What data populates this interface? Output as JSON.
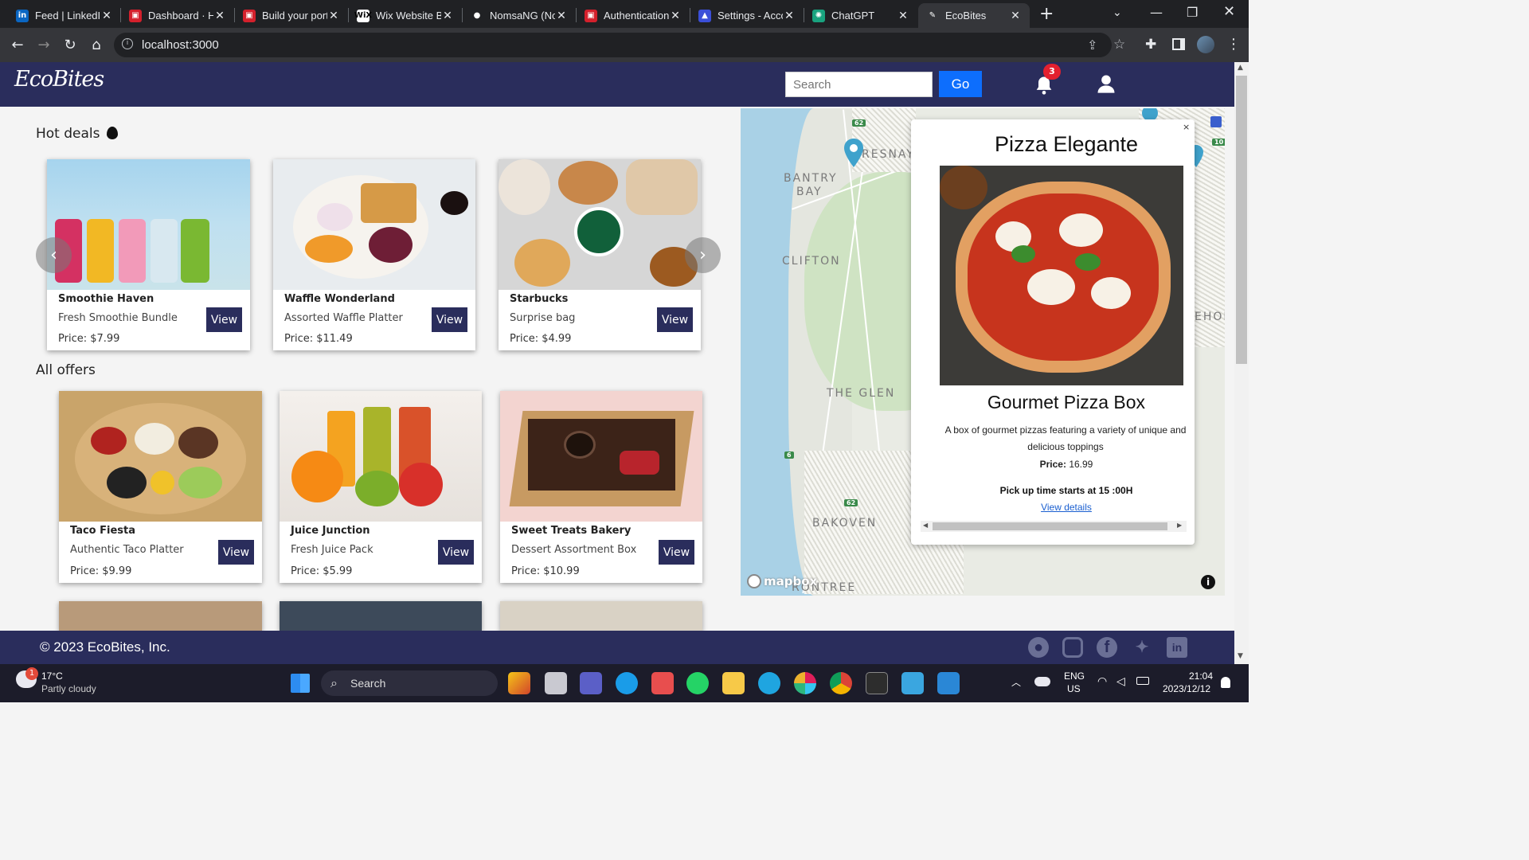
{
  "browser": {
    "tabs": [
      {
        "label": "Feed | LinkedIn",
        "fav_color": "#0a66c2",
        "fav_text": "in"
      },
      {
        "label": "Dashboard · Heroku",
        "fav_color": "#d4202c",
        "fav_text": "▣"
      },
      {
        "label": "Build your portfolio",
        "fav_color": "#d4202c",
        "fav_text": "▣"
      },
      {
        "label": "Wix Website Builder",
        "fav_color": "#ffffff",
        "fav_text": "WiX"
      },
      {
        "label": "NomsaNG (Nomsa)",
        "fav_color": "#202124",
        "fav_text": "●"
      },
      {
        "label": "Authentication",
        "fav_color": "#d4202c",
        "fav_text": "▣"
      },
      {
        "label": "Settings - Account",
        "fav_color": "#3b4fd8",
        "fav_text": "▲"
      },
      {
        "label": "ChatGPT",
        "fav_color": "#19a37f",
        "fav_text": "✺"
      },
      {
        "label": "EcoBites",
        "fav_color": "#35363a",
        "fav_text": "✎"
      }
    ],
    "active_tab": "EcoBites",
    "url": "localhost:3000"
  },
  "navbar": {
    "logo": "EcoBites",
    "search_placeholder": "Search",
    "go_label": "Go",
    "notification_count": "3"
  },
  "hot_deals": {
    "title": "Hot deals",
    "cards": [
      {
        "name": "Smoothie Haven",
        "desc": "Fresh Smoothie Bundle",
        "price": "Price: $7.99",
        "view": "View"
      },
      {
        "name": "Waffle Wonderland",
        "desc": "Assorted Waffle Platter",
        "price": "Price: $11.49",
        "view": "View"
      },
      {
        "name": "Starbucks",
        "desc": "Surprise bag",
        "price": "Price: $4.99",
        "view": "View"
      }
    ]
  },
  "all_offers": {
    "title": "All offers",
    "cards": [
      {
        "name": "Taco Fiesta",
        "desc": "Authentic Taco Platter",
        "price": "Price: $9.99",
        "view": "View"
      },
      {
        "name": "Juice Junction",
        "desc": "Fresh Juice Pack",
        "price": "Price: $5.99",
        "view": "View"
      },
      {
        "name": "Sweet Treats Bakery",
        "desc": "Dessert Assortment Box",
        "price": "Price: $10.99",
        "view": "View"
      }
    ]
  },
  "map": {
    "labels": [
      "RESNAY",
      "BANTRY",
      "BAY",
      "CLIFTON",
      "THE GLEN",
      "BAKOVEN",
      "RONTREE",
      "EHOE"
    ],
    "routes": [
      "62",
      "6",
      "62",
      "10"
    ],
    "attribution": "mapbox"
  },
  "popup": {
    "close": "×",
    "title": "Pizza Elegante",
    "subtitle": "Gourmet Pizza Box",
    "description": "A box of gourmet pizzas featuring a variety of unique and delicious toppings",
    "price_label": "Price:",
    "price_value": "16.99",
    "pickup": "Pick up time starts at 15 :00H",
    "link": "View details"
  },
  "footer": {
    "copyright": "© 2023 EcoBites, Inc."
  },
  "taskbar": {
    "weather_temp": "17°C",
    "weather_desc": "Partly cloudy",
    "search": "Search",
    "lang": "ENG",
    "region": "US",
    "time": "21:04",
    "date": "2023/12/12"
  }
}
